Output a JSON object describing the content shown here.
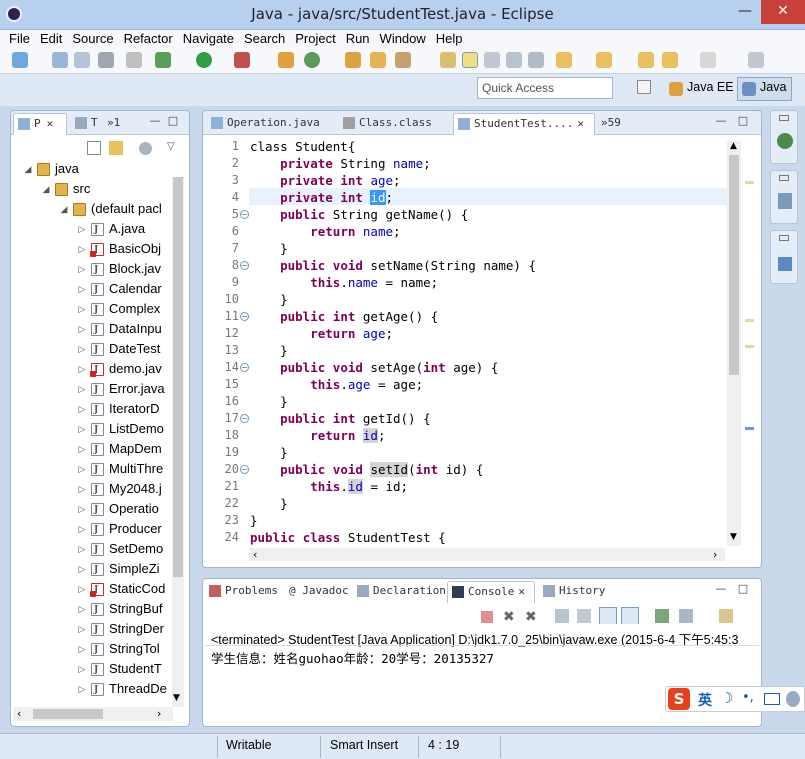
{
  "window": {
    "title": "Java - java/src/StudentTest.java - Eclipse",
    "minimize": "—",
    "maximize": "□",
    "close": "✕"
  },
  "menu": [
    "File",
    "Edit",
    "Source",
    "Refactor",
    "Navigate",
    "Search",
    "Project",
    "Run",
    "Window",
    "Help"
  ],
  "quick_access": {
    "placeholder": "Quick Access"
  },
  "perspectives": [
    {
      "label": "Java EE",
      "active": false
    },
    {
      "label": "Java",
      "active": true
    }
  ],
  "explorer": {
    "tabs": [
      {
        "label": "P",
        "active": true
      },
      {
        "label": "T",
        "active": false
      },
      {
        "label": "»1",
        "active": false
      }
    ],
    "project": "java",
    "src": "src",
    "package": "(default pacl",
    "files": [
      {
        "name": "A.java",
        "error": false
      },
      {
        "name": "BasicObj",
        "error": true
      },
      {
        "name": "Block.jav",
        "error": false
      },
      {
        "name": "Calendar",
        "error": false
      },
      {
        "name": "Complex",
        "error": false
      },
      {
        "name": "DataInpu",
        "error": false
      },
      {
        "name": "DateTest",
        "error": false
      },
      {
        "name": "demo.jav",
        "error": true
      },
      {
        "name": "Error.java",
        "error": false
      },
      {
        "name": "IteratorD",
        "error": false
      },
      {
        "name": "ListDemo",
        "error": false
      },
      {
        "name": "MapDem",
        "error": false
      },
      {
        "name": "MultiThre",
        "error": false
      },
      {
        "name": "My2048.j",
        "error": false
      },
      {
        "name": "Operatio",
        "error": false
      },
      {
        "name": "Producer",
        "error": false
      },
      {
        "name": "SetDemo",
        "error": false
      },
      {
        "name": "SimpleZi",
        "error": false
      },
      {
        "name": "StaticCod",
        "error": true
      },
      {
        "name": "StringBuf",
        "error": false
      },
      {
        "name": "StringDer",
        "error": false
      },
      {
        "name": "StringTol",
        "error": false
      },
      {
        "name": "StudentT",
        "error": false
      },
      {
        "name": "ThreadDe",
        "error": false
      }
    ]
  },
  "editor": {
    "tabs": [
      {
        "label": "Operation.java",
        "active": false
      },
      {
        "label": "Class.class",
        "active": false
      },
      {
        "label": "StudentTest....",
        "active": true,
        "close": "✕"
      },
      {
        "label": "»59",
        "active": false
      }
    ],
    "lines": [
      {
        "n": "1"
      },
      {
        "n": "2"
      },
      {
        "n": "3"
      },
      {
        "n": "4"
      },
      {
        "n": "5",
        "fold": "−"
      },
      {
        "n": "6"
      },
      {
        "n": "7"
      },
      {
        "n": "8",
        "fold": "−"
      },
      {
        "n": "9"
      },
      {
        "n": "10"
      },
      {
        "n": "11",
        "fold": "−"
      },
      {
        "n": "12"
      },
      {
        "n": "13"
      },
      {
        "n": "14",
        "fold": "−"
      },
      {
        "n": "15"
      },
      {
        "n": "16"
      },
      {
        "n": "17",
        "fold": "−"
      },
      {
        "n": "18"
      },
      {
        "n": "19"
      },
      {
        "n": "20",
        "fold": "−"
      },
      {
        "n": "21"
      },
      {
        "n": "22"
      },
      {
        "n": "23"
      },
      {
        "n": "24"
      }
    ],
    "code": [
      [
        {
          "t": "class Student{"
        }
      ],
      [
        {
          "t": "    "
        },
        {
          "t": "private",
          "c": "kw"
        },
        {
          "t": " String "
        },
        {
          "t": "name",
          "c": "fld"
        },
        {
          "t": ";"
        }
      ],
      [
        {
          "t": "    "
        },
        {
          "t": "private",
          "c": "kw"
        },
        {
          "t": " "
        },
        {
          "t": "int",
          "c": "kw"
        },
        {
          "t": " "
        },
        {
          "t": "age",
          "c": "fld"
        },
        {
          "t": ";"
        }
      ],
      [
        {
          "t": "    "
        },
        {
          "t": "private",
          "c": "kw"
        },
        {
          "t": " "
        },
        {
          "t": "int",
          "c": "kw"
        },
        {
          "t": " "
        },
        {
          "t": "id",
          "c": "sel"
        },
        {
          "t": ";"
        }
      ],
      [
        {
          "t": "    "
        },
        {
          "t": "public",
          "c": "kw"
        },
        {
          "t": " String getName() {"
        }
      ],
      [
        {
          "t": "        "
        },
        {
          "t": "return",
          "c": "kw"
        },
        {
          "t": " "
        },
        {
          "t": "name",
          "c": "fld"
        },
        {
          "t": ";"
        }
      ],
      [
        {
          "t": "    }"
        }
      ],
      [
        {
          "t": "    "
        },
        {
          "t": "public",
          "c": "kw"
        },
        {
          "t": " "
        },
        {
          "t": "void",
          "c": "kw"
        },
        {
          "t": " setName(String name) {"
        }
      ],
      [
        {
          "t": "        "
        },
        {
          "t": "this",
          "c": "kw"
        },
        {
          "t": "."
        },
        {
          "t": "name",
          "c": "fld"
        },
        {
          "t": " = name;"
        }
      ],
      [
        {
          "t": "    }"
        }
      ],
      [
        {
          "t": "    "
        },
        {
          "t": "public",
          "c": "kw"
        },
        {
          "t": " "
        },
        {
          "t": "int",
          "c": "kw"
        },
        {
          "t": " getAge() {"
        }
      ],
      [
        {
          "t": "        "
        },
        {
          "t": "return",
          "c": "kw"
        },
        {
          "t": " "
        },
        {
          "t": "age",
          "c": "fld"
        },
        {
          "t": ";"
        }
      ],
      [
        {
          "t": "    }"
        }
      ],
      [
        {
          "t": "    "
        },
        {
          "t": "public",
          "c": "kw"
        },
        {
          "t": " "
        },
        {
          "t": "void",
          "c": "kw"
        },
        {
          "t": " setAge("
        },
        {
          "t": "int",
          "c": "kw"
        },
        {
          "t": " age) {"
        }
      ],
      [
        {
          "t": "        "
        },
        {
          "t": "this",
          "c": "kw"
        },
        {
          "t": "."
        },
        {
          "t": "age",
          "c": "fld"
        },
        {
          "t": " = age;"
        }
      ],
      [
        {
          "t": "    }"
        }
      ],
      [
        {
          "t": "    "
        },
        {
          "t": "public",
          "c": "kw"
        },
        {
          "t": " "
        },
        {
          "t": "int",
          "c": "kw"
        },
        {
          "t": " getId() {"
        }
      ],
      [
        {
          "t": "        "
        },
        {
          "t": "return",
          "c": "kw"
        },
        {
          "t": " "
        },
        {
          "t": "id",
          "c": "fld occ"
        },
        {
          "t": ";"
        }
      ],
      [
        {
          "t": "    }"
        }
      ],
      [
        {
          "t": "    "
        },
        {
          "t": "public",
          "c": "kw"
        },
        {
          "t": " "
        },
        {
          "t": "void",
          "c": "kw"
        },
        {
          "t": " "
        },
        {
          "t": "setId",
          "c": "occ"
        },
        {
          "t": "("
        },
        {
          "t": "int",
          "c": "kw"
        },
        {
          "t": " id) {"
        }
      ],
      [
        {
          "t": "        "
        },
        {
          "t": "this",
          "c": "kw"
        },
        {
          "t": "."
        },
        {
          "t": "id",
          "c": "fld occ"
        },
        {
          "t": " = id;"
        }
      ],
      [
        {
          "t": "    }"
        }
      ],
      [
        {
          "t": "}"
        }
      ],
      [
        {
          "t": "public",
          "c": "kw"
        },
        {
          "t": " "
        },
        {
          "t": "class",
          "c": "kw"
        },
        {
          "t": " StudentTest {"
        }
      ]
    ]
  },
  "bottom": {
    "tabs": [
      {
        "label": "Problems",
        "active": false
      },
      {
        "label": "@ Javadoc",
        "active": false
      },
      {
        "label": "Declaration",
        "active": false
      },
      {
        "label": "Console",
        "active": true,
        "close": "✕"
      },
      {
        "label": "History",
        "active": false
      }
    ],
    "status_line": "<terminated> StudentTest [Java Application] D:\\jdk1.7.0_25\\bin\\javaw.exe (2015-6-4 下午5:45:3",
    "output": "学生信息：姓名guohao年龄：20学号：20135327"
  },
  "statusbar": {
    "writable": "Writable",
    "insert_mode": "Smart Insert",
    "position": "4 : 19"
  },
  "ime": {
    "lang": "英",
    "moon": "☽",
    "dot": "•,"
  },
  "colors": {
    "keyword": "#7f0055",
    "field": "#0000c0",
    "selection": "#3399ff",
    "current_line": "#e8f2fe",
    "error": "#d32020"
  }
}
